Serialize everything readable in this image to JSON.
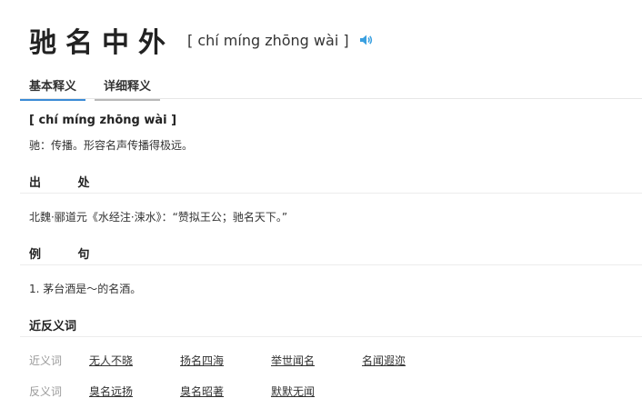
{
  "header": {
    "word": "驰名中外",
    "pinyin": "[ chí míng zhōng wài ]"
  },
  "tabs": [
    {
      "label": "基本释义",
      "active": true
    },
    {
      "label": "详细释义",
      "active": false
    }
  ],
  "basic": {
    "pinyin": "[ chí míng zhōng wài ]",
    "definition": "驰：传播。形容名声传播得极远。"
  },
  "source": {
    "title": "出 处",
    "text": "北魏·郦道元《水经注·涑水》：“赞拟王公；驰名天下。”"
  },
  "example": {
    "title": "例 句",
    "text": "1. 茅台酒是～的名酒。"
  },
  "relations": {
    "title": "近反义词",
    "synonym_label": "近义词",
    "synonyms": [
      "无人不晓",
      "扬名四海",
      "举世闻名",
      "名闻遐迩"
    ],
    "antonym_label": "反义词",
    "antonyms": [
      "臭名远扬",
      "臭名昭著",
      "默默无闻"
    ]
  },
  "colors": {
    "accent": "#3a8bd6",
    "sound_icon": "#3aa0e0"
  }
}
